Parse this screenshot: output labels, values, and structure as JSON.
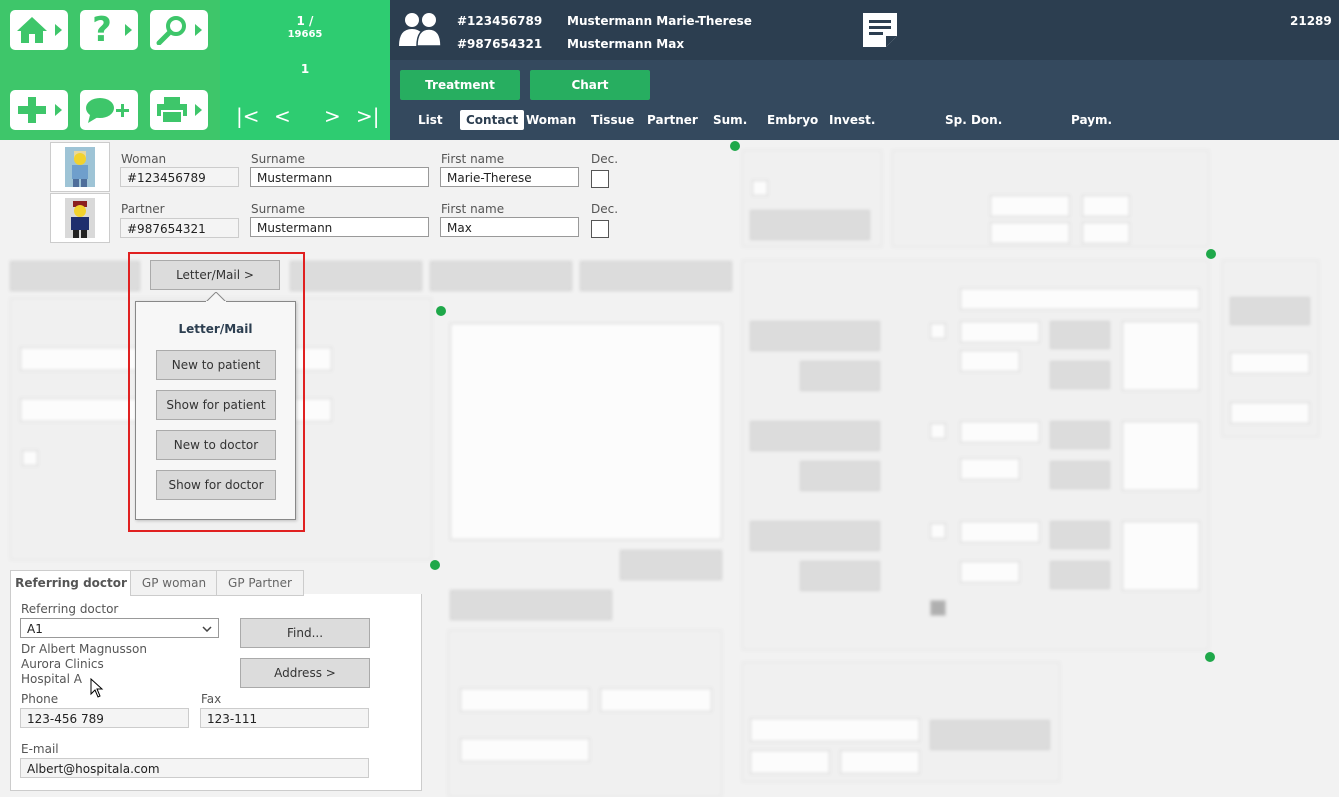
{
  "nav": {
    "buttons": [
      {
        "icon": "home-icon"
      },
      {
        "icon": "help-icon"
      },
      {
        "icon": "search-icon"
      },
      {
        "icon": "add-icon"
      },
      {
        "icon": "comment-add-icon"
      },
      {
        "icon": "printer-icon"
      }
    ]
  },
  "pager": {
    "position": "1 /",
    "total": "19665",
    "current": "1"
  },
  "header": {
    "woman_id": "#123456789",
    "woman_name": "Mustermann Marie-Therese",
    "partner_id": "#987654321",
    "partner_name": "Mustermann Max",
    "record_no": "21289",
    "buttons": {
      "treatment": "Treatment",
      "chart": "Chart"
    },
    "tabs": [
      "List",
      "Contact",
      "Woman",
      "Tissue",
      "Partner",
      "Sum.",
      "Embryo",
      "Invest.",
      "Sp. Don.",
      "Paym."
    ],
    "active_tab": "Contact"
  },
  "patient": {
    "labels": {
      "woman": "Woman",
      "partner": "Partner",
      "surname": "Surname",
      "firstname": "First name",
      "dec": "Dec."
    },
    "woman": {
      "id": "#123456789",
      "surname": "Mustermann",
      "firstname": "Marie-Therese"
    },
    "partner": {
      "id": "#987654321",
      "surname": "Mustermann",
      "firstname": "Max"
    }
  },
  "letter_mail": {
    "button": "Letter/Mail >",
    "title": "Letter/Mail",
    "items": [
      "New to patient",
      "Show for patient",
      "New to doctor",
      "Show for doctor"
    ]
  },
  "referring": {
    "tabs": [
      "Referring doctor",
      "GP woman",
      "GP Partner"
    ],
    "label": "Referring doctor",
    "selected": "A1",
    "doctor": "Dr Albert Magnusson",
    "clinic": "Aurora Clinics",
    "hospital": "Hospital A",
    "phone_label": "Phone",
    "phone": "123-456 789",
    "fax_label": "Fax",
    "fax": "123-111",
    "email_label": "E-mail",
    "email": "Albert@hospitala.com",
    "find": "Find...",
    "address": "Address >"
  },
  "colors": {
    "nav_green": "#3ec66a",
    "pager_green": "#2ecc71",
    "header_dark": "#2c3e50",
    "tab_bar": "#34495e",
    "button_green": "#27ae60",
    "highlight_red": "#e02020"
  }
}
